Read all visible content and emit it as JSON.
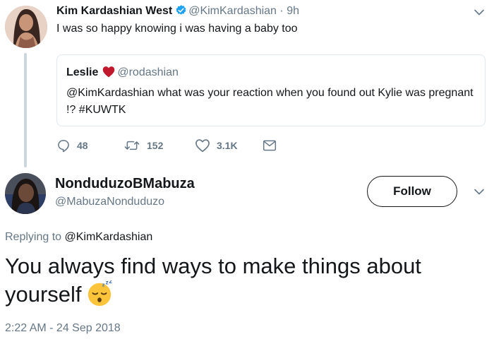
{
  "original_tweet": {
    "author_name": "Kim Kardashian West",
    "handle": "@KimKardashian",
    "separator": "·",
    "time": "9h",
    "text": "I was so happy knowing i was having a baby too",
    "verified_icon": "verified-badge-icon",
    "avatar_icon": "avatar-photo"
  },
  "quoted_tweet": {
    "author_name": "Leslie",
    "heart_icon": "heart-icon",
    "heart_color": "#c0182c",
    "handle": "@rodashian",
    "text": "@KimKardashian  what was your reaction when you found out Kylie was pregnant !? #KUWTK"
  },
  "actions": {
    "reply_count": "48",
    "retweet_count": "152",
    "like_count": "3.1K",
    "icons": [
      "reply-icon",
      "retweet-icon",
      "like-icon",
      "message-icon"
    ]
  },
  "reply_tweet": {
    "author_name": "NonduduzoBMabuza",
    "handle": "@MabuzaNonduduzo",
    "follow_label": "Follow",
    "replying_prefix": "Replying to",
    "replying_to": "@KimKardashian",
    "text": "You always find ways to make things about yourself",
    "emoji_icon": "sleeping-face-emoji",
    "timestamp": "2:22 AM - 24 Sep 2018"
  },
  "colors": {
    "text": "#14171a",
    "secondary": "#657786",
    "verified": "#1da1f2",
    "border": "#e1e8ed",
    "thread_line": "#ccd6dd"
  }
}
